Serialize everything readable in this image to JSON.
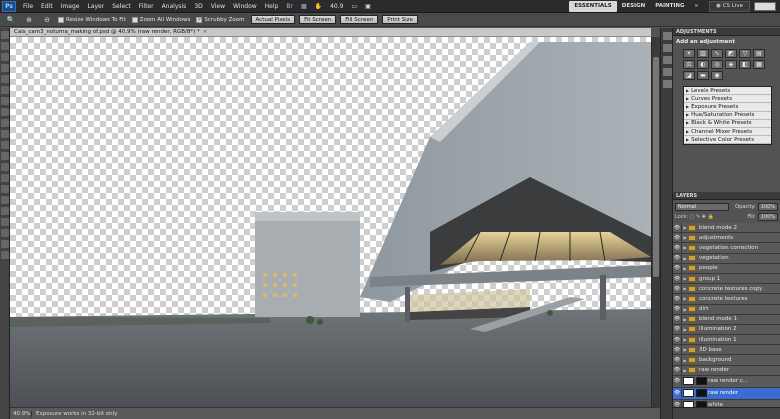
{
  "menubar": {
    "logo": "Ps",
    "items": [
      "File",
      "Edit",
      "Image",
      "Layer",
      "Select",
      "Filter",
      "Analysis",
      "3D",
      "View",
      "Window",
      "Help"
    ],
    "zoom": "40.9",
    "workspaces": [
      "ESSENTIALS",
      "DESIGN",
      "PAINTING"
    ],
    "active_workspace": "ESSENTIALS",
    "more": "»",
    "cs_live": "CS Live"
  },
  "options": {
    "resize_windows": "Resize Windows To Fit",
    "zoom_all": "Zoom All Windows",
    "scrubby": "Scrubby Zoom",
    "actual_pixels": "Actual Pixels",
    "fit_screen": "Fit Screen",
    "fill_screen": "Fill Screen",
    "print_size": "Print Size"
  },
  "document": {
    "tab_title": "Cais_cam3_noturna_making of.psd @ 40,9% (raw render, RGB/8*) *",
    "ruler_marks": [
      "0",
      "50",
      "100",
      "150",
      "200",
      "250",
      "300",
      "350",
      "400",
      "450",
      "500",
      "550",
      "600",
      "650",
      "700",
      "750",
      "800",
      "850",
      "900",
      "950",
      "1000",
      "1050",
      "1100",
      "1150",
      "1200",
      "1250",
      "1300",
      "1350",
      "1400",
      "1450",
      "1500",
      "1550",
      "1600",
      "1650",
      "1700",
      "1750",
      "1800",
      "1850",
      "1900",
      "1950",
      "2000",
      "2050",
      "2100",
      "2150",
      "2200",
      "2250",
      "2300",
      "2350",
      "2400",
      "2450",
      "2500",
      "2550",
      "2600",
      "2650",
      "2700",
      "2750",
      "2800",
      "2850",
      "2900",
      "2950",
      "3000",
      "3050",
      "3100",
      "3150"
    ]
  },
  "status": {
    "zoom": "40.9%",
    "message": "Exposure works in 32-bit only"
  },
  "adjustments": {
    "tab": "ADJUSTMENTS",
    "title": "Add an adjustment",
    "presets": [
      "Levels Presets",
      "Curves Presets",
      "Exposure Presets",
      "Hue/Saturation Presets",
      "Black & White Presets",
      "Channel Mixer Presets",
      "Selective Color Presets"
    ]
  },
  "layers": {
    "tab": "LAYERS",
    "blend_mode": "Normal",
    "opacity_label": "Opacity:",
    "opacity": "100%",
    "fill_label": "Fill:",
    "fill": "100%",
    "lock_label": "Lock:",
    "items": [
      {
        "name": "blend mode 2",
        "kind": "folder"
      },
      {
        "name": "adjustments",
        "kind": "folder"
      },
      {
        "name": "vegetation correction",
        "kind": "folder"
      },
      {
        "name": "vegetation",
        "kind": "folder"
      },
      {
        "name": "people",
        "kind": "folder"
      },
      {
        "name": "group 1",
        "kind": "folder"
      },
      {
        "name": "concrete textures copy",
        "kind": "folder"
      },
      {
        "name": "concrete textures",
        "kind": "folder"
      },
      {
        "name": "dirt",
        "kind": "folder"
      },
      {
        "name": "blend mode 1",
        "kind": "folder"
      },
      {
        "name": "illumination 2",
        "kind": "folder"
      },
      {
        "name": "illumination 1",
        "kind": "folder"
      },
      {
        "name": "3D base",
        "kind": "folder"
      },
      {
        "name": "background",
        "kind": "folder"
      },
      {
        "name": "raw render",
        "kind": "folder"
      },
      {
        "name": "raw render c...",
        "kind": "layer"
      },
      {
        "name": "raw render",
        "kind": "layer"
      },
      {
        "name": "white",
        "kind": "layer"
      }
    ]
  }
}
